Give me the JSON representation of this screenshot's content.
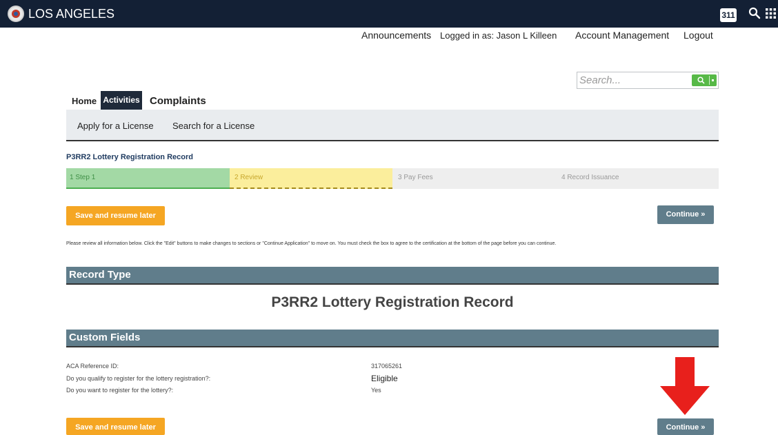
{
  "topbar": {
    "city": "LOS ANGELES",
    "badge_311": "311",
    "icons": [
      "seal-icon",
      "search-icon",
      "apps-grid-icon"
    ]
  },
  "user_nav": {
    "announcements": "Announcements",
    "logged_in": "Logged in as: Jason L Killeen",
    "account_management": "Account Management",
    "logout": "Logout"
  },
  "search": {
    "placeholder": "Search..."
  },
  "tabs": {
    "home": "Home",
    "activities": "Activities",
    "complaints": "Complaints",
    "active": "Activities"
  },
  "subnav": {
    "apply": "Apply for a License",
    "search_license": "Search for a License"
  },
  "record": {
    "title": "P3RR2 Lottery Registration Record"
  },
  "steps": [
    {
      "label": "1  Step 1",
      "state": "complete"
    },
    {
      "label": "2  Review",
      "state": "current"
    },
    {
      "label": "3  Pay Fees",
      "state": "pending"
    },
    {
      "label": "4  Record Issuance",
      "state": "pending"
    }
  ],
  "buttons": {
    "save_resume": "Save and resume later",
    "continue": "Continue »"
  },
  "instructions": "Please review all information below. Click the \"Edit\" buttons to make changes to sections or \"Continue Application\" to move on. You must check the box to agree to the certification at the bottom of the page before you can continue.",
  "record_type": {
    "header": "Record Type",
    "value": "P3RR2 Lottery Registration Record"
  },
  "custom_fields": {
    "header": "Custom Fields",
    "rows": [
      {
        "label": "ACA Reference ID:",
        "value": "317065261"
      },
      {
        "label": "Do you qualify to register for the lottery registration?:",
        "value": "Eligible"
      },
      {
        "label": "Do you want to register for the lottery?:",
        "value": "Yes"
      }
    ]
  },
  "colors": {
    "topbar": "#132035",
    "step_complete": "#a3d9a5",
    "step_current": "#fbee9c",
    "save_button": "#f5a623",
    "continue_button": "#607d8b",
    "section_header": "#607d8b",
    "arrow": "#e8201c"
  }
}
